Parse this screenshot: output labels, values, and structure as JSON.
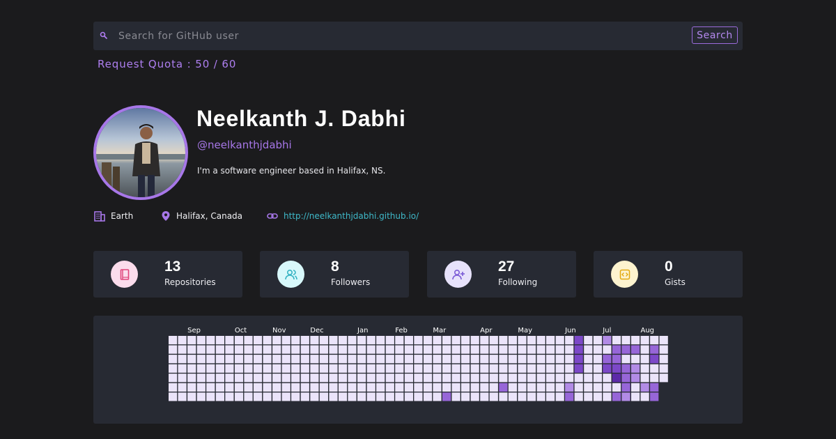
{
  "search": {
    "placeholder": "Search for GitHub user",
    "value": "",
    "button_label": "Search"
  },
  "quota": {
    "text": "Request Quota : 50 / 60"
  },
  "profile": {
    "name": "Neelkanth J. Dabhi",
    "handle": "@neelkanthjdabhi",
    "bio": "I'm a software engineer based in Halifax, NS.",
    "avatar_icon": "user-photo"
  },
  "meta": {
    "company": {
      "icon": "building-icon",
      "text": "Earth"
    },
    "location": {
      "icon": "map-pin-icon",
      "text": "Halifax, Canada"
    },
    "website": {
      "icon": "link-icon",
      "text": "http://neelkanthjdabhi.github.io/"
    }
  },
  "stats": [
    {
      "count": "13",
      "label": "Repositories",
      "icon": "book-icon",
      "bg": "#fbdcec",
      "fg": "#e0457b"
    },
    {
      "count": "8",
      "label": "Followers",
      "icon": "users-icon",
      "bg": "#d8f8fb",
      "fg": "#36b3c3"
    },
    {
      "count": "27",
      "label": "Following",
      "icon": "user-plus-icon",
      "bg": "#e7e2fb",
      "fg": "#7b5bd6"
    },
    {
      "count": "0",
      "label": "Gists",
      "icon": "code-icon",
      "bg": "#fdf3cf",
      "fg": "#e3a90f"
    }
  ],
  "contributions": {
    "months": [
      "Sep",
      "Oct",
      "Nov",
      "Dec",
      "Jan",
      "Feb",
      "Mar",
      "Apr",
      "May",
      "Jun",
      "Jul",
      "Aug"
    ],
    "month_start_week": [
      2,
      7,
      11,
      15,
      20,
      24,
      28,
      33,
      37,
      42,
      46,
      50
    ],
    "weeks": 53,
    "days": 7,
    "last_week_days": 5,
    "levels_colors": [
      "#ebe4fa",
      "#b28be6",
      "#9766d8",
      "#7c48c8",
      "#5c2aa9"
    ],
    "active": [
      {
        "week": 43,
        "day": 0,
        "level": 3
      },
      {
        "week": 43,
        "day": 1,
        "level": 3
      },
      {
        "week": 43,
        "day": 2,
        "level": 3
      },
      {
        "week": 43,
        "day": 3,
        "level": 3
      },
      {
        "week": 46,
        "day": 0,
        "level": 1
      },
      {
        "week": 47,
        "day": 1,
        "level": 2
      },
      {
        "week": 48,
        "day": 1,
        "level": 2
      },
      {
        "week": 49,
        "day": 1,
        "level": 2
      },
      {
        "week": 51,
        "day": 1,
        "level": 2
      },
      {
        "week": 51,
        "day": 2,
        "level": 3
      },
      {
        "week": 46,
        "day": 2,
        "level": 2
      },
      {
        "week": 47,
        "day": 2,
        "level": 2
      },
      {
        "week": 46,
        "day": 3,
        "level": 3
      },
      {
        "week": 47,
        "day": 3,
        "level": 3
      },
      {
        "week": 48,
        "day": 3,
        "level": 2
      },
      {
        "week": 49,
        "day": 3,
        "level": 1
      },
      {
        "week": 47,
        "day": 4,
        "level": 4
      },
      {
        "week": 48,
        "day": 4,
        "level": 2
      },
      {
        "week": 49,
        "day": 4,
        "level": 1
      },
      {
        "week": 48,
        "day": 5,
        "level": 2
      },
      {
        "week": 50,
        "day": 5,
        "level": 1
      },
      {
        "week": 51,
        "day": 5,
        "level": 2
      },
      {
        "week": 35,
        "day": 5,
        "level": 2
      },
      {
        "week": 42,
        "day": 5,
        "level": 1
      },
      {
        "week": 42,
        "day": 6,
        "level": 2
      },
      {
        "week": 47,
        "day": 6,
        "level": 2
      },
      {
        "week": 48,
        "day": 6,
        "level": 1
      },
      {
        "week": 51,
        "day": 6,
        "level": 2
      },
      {
        "week": 29,
        "day": 6,
        "level": 2
      }
    ]
  }
}
